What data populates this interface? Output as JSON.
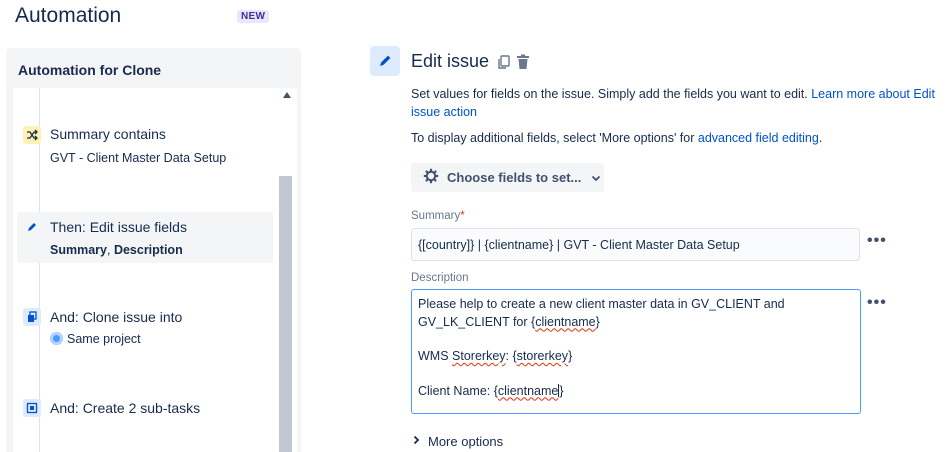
{
  "header": {
    "title": "Automation",
    "badge": "NEW"
  },
  "rule_panel": {
    "title": "Automation for Clone",
    "items": [
      {
        "icon": "shuffle-icon",
        "label": "Summary contains",
        "sub": "GVT - Client Master Data Setup"
      },
      {
        "icon": "pencil-icon",
        "label": "Then: Edit issue fields",
        "sub_parts": [
          "Summary",
          ", ",
          "Description"
        ]
      },
      {
        "icon": "clone-icon",
        "label": "And: Clone issue into",
        "sub": "Same project",
        "sub_icon": "project-avatar-icon"
      },
      {
        "icon": "subtask-icon",
        "label": "And: Create 2 sub-tasks"
      }
    ]
  },
  "editor": {
    "title": "Edit issue",
    "desc1_text": "Set values for fields on the issue. Simply add the fields you want to edit. ",
    "desc1_link": "Learn more about Edit issue action",
    "desc2_text": "To display additional fields, select 'More options' for ",
    "desc2_link": "advanced field editing",
    "desc2_end": ".",
    "choose_fields_label": "Choose fields to set...",
    "summary_label": "Summary",
    "summary_required": "*",
    "summary_value": "{[country]} | {clientname} | GVT - Client Master Data Setup",
    "description_label": "Description",
    "description": {
      "line1": "Please help to create a new client master data in GV_CLIENT and",
      "line2_pre": "GV_LK_CLIENT for {",
      "line2_word": "clientname",
      "line2_post": "}",
      "line3_pre": "WMS ",
      "line3_word1": "Storerkey",
      "line3_mid": ": {",
      "line3_word2": "storerkey",
      "line3_post": "}",
      "line4_pre": "Client Name: {",
      "line4_word": "clientname",
      "line4_post": "}"
    },
    "more_dots": "•••",
    "more_options_label": "More options"
  },
  "colors": {
    "accent": "#0052cc",
    "focus": "#4c9aff",
    "required": "#de350b",
    "badge_bg": "#eae6ff",
    "badge_text": "#403294"
  }
}
